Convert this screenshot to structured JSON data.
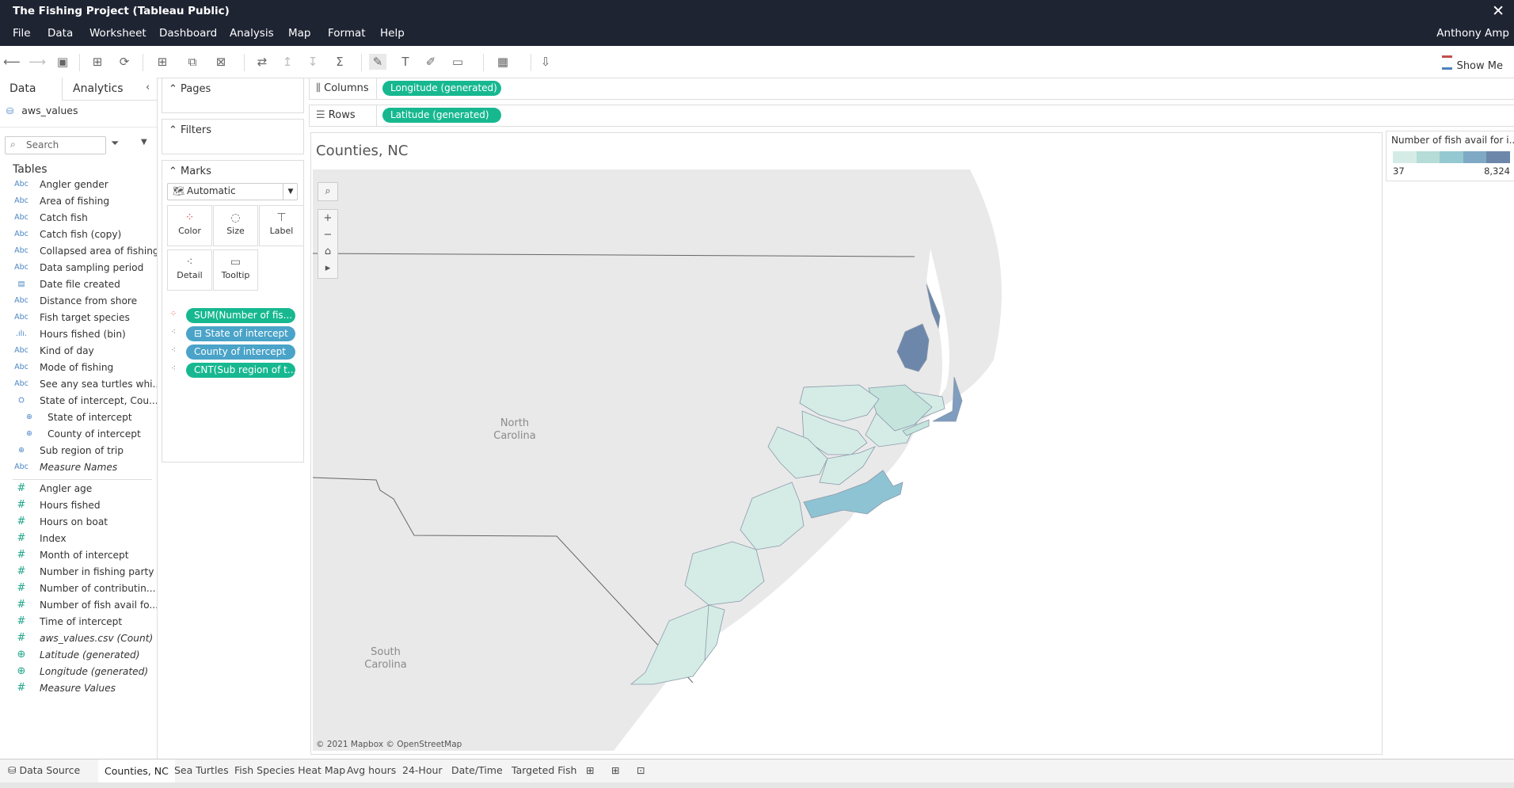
{
  "window": {
    "title": "The Fishing Project (Tableau Public)",
    "close": "✕"
  },
  "menu": {
    "items": [
      "File",
      "Data",
      "Worksheet",
      "Dashboard",
      "Analysis",
      "Map",
      "Format",
      "Help"
    ],
    "user": "Anthony Amp"
  },
  "toolbar": {
    "show_me": "Show Me"
  },
  "data_pane": {
    "tabs": [
      "Data",
      "Analytics"
    ],
    "datasource": "aws_values",
    "search_placeholder": "Search",
    "tables_heading": "Tables",
    "dimensions": [
      {
        "icon": "Abc",
        "label": "Angler gender"
      },
      {
        "icon": "Abc",
        "label": "Area of fishing"
      },
      {
        "icon": "Abc",
        "label": "Catch fish"
      },
      {
        "icon": "Abc",
        "label": "Catch fish (copy)"
      },
      {
        "icon": "Abc",
        "label": "Collapsed area of fishing"
      },
      {
        "icon": "Abc",
        "label": "Data sampling period"
      },
      {
        "icon": "▤",
        "label": "Date file created"
      },
      {
        "icon": "Abc",
        "label": "Distance from shore"
      },
      {
        "icon": "Abc",
        "label": "Fish target species"
      },
      {
        "icon": ".ılı.",
        "label": "Hours fished (bin)"
      },
      {
        "icon": "Abc",
        "label": "Kind of day"
      },
      {
        "icon": "Abc",
        "label": "Mode of fishing"
      },
      {
        "icon": "Abc",
        "label": "See any sea turtles whi..."
      },
      {
        "icon": "⛭",
        "label": "State of intercept, Cou..."
      },
      {
        "icon": "⊕",
        "label": "State of intercept"
      },
      {
        "icon": "⊕",
        "label": "County of intercept"
      },
      {
        "icon": "⊕",
        "label": "Sub region of trip"
      },
      {
        "icon": "Abc",
        "label": "Measure Names"
      }
    ],
    "measures": [
      {
        "icon": "#",
        "label": "Angler age"
      },
      {
        "icon": "#",
        "label": "Hours fished"
      },
      {
        "icon": "#",
        "label": "Hours on boat"
      },
      {
        "icon": "#",
        "label": "Index"
      },
      {
        "icon": "#",
        "label": "Month of intercept"
      },
      {
        "icon": "#",
        "label": "Number in fishing party"
      },
      {
        "icon": "#",
        "label": "Number of contributin..."
      },
      {
        "icon": "#",
        "label": "Number of fish avail fo..."
      },
      {
        "icon": "#",
        "label": "Time of intercept"
      },
      {
        "icon": "#",
        "label": "aws_values.csv (Count)"
      },
      {
        "icon": "⊕",
        "label": "Latitude (generated)"
      },
      {
        "icon": "⊕",
        "label": "Longitude (generated)"
      },
      {
        "icon": "#",
        "label": "Measure Values"
      }
    ]
  },
  "cards": {
    "pages": "Pages",
    "filters": "Filters",
    "marks": "Marks",
    "mark_type": "Automatic",
    "mark_buttons": [
      "Color",
      "Size",
      "Label",
      "Detail",
      "Tooltip"
    ],
    "mark_fields": [
      {
        "label": "SUM(Number of fis...",
        "kind": "measure"
      },
      {
        "label": "⊟ State of intercept",
        "kind": "dimension"
      },
      {
        "label": "County of intercept",
        "kind": "dimension"
      },
      {
        "label": "CNT(Sub region of t...",
        "kind": "measure"
      }
    ]
  },
  "shelves": {
    "columns_label": "Columns",
    "columns_pill": "Longitude (generated)",
    "rows_label": "Rows",
    "rows_pill": "Latitude (generated)"
  },
  "viz": {
    "title": "Counties, NC",
    "state_labels": [
      "North\nCarolina",
      "South\nCarolina"
    ],
    "attribution": "© 2021 Mapbox © OpenStreetMap"
  },
  "legend": {
    "title": "Number of fish avail for i...",
    "min": "37",
    "max": "8,324"
  },
  "sheet_tabs": {
    "datasource": "Data Source",
    "sheets": [
      "Counties, NC",
      "Sea Turtles",
      "Fish Species Heat Map",
      "Avg hours",
      "24-Hour",
      "Date/Time",
      "Targeted Fish"
    ],
    "active": "Counties, NC"
  },
  "colors": {
    "titlebar": "#1f2433",
    "measure_pill": "#17b890",
    "dimension_pill": "#4aa3c8",
    "low": "#d5ece6",
    "high": "#6d87ab"
  }
}
